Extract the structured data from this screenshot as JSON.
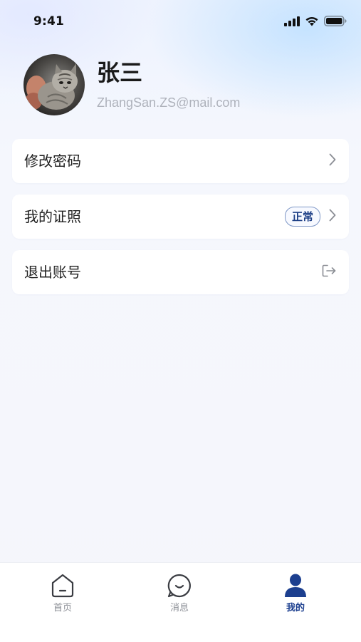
{
  "status_bar": {
    "time": "9:41",
    "icons": [
      "cellular-signal-icon",
      "wifi-icon",
      "battery-icon"
    ]
  },
  "profile": {
    "name": "张三",
    "email": "ZhangSan.ZS@mail.com",
    "avatar": "cat-photo-avatar"
  },
  "menu": {
    "items": [
      {
        "label": "修改密码",
        "icon": "chevron-right-icon"
      },
      {
        "label": "我的证照",
        "badge": "正常",
        "icon": "chevron-right-icon"
      },
      {
        "label": "退出账号",
        "icon": "logout-icon"
      }
    ]
  },
  "tab_bar": {
    "tabs": [
      {
        "label": "首页",
        "icon": "home-icon",
        "active": false
      },
      {
        "label": "消息",
        "icon": "message-icon",
        "active": false
      },
      {
        "label": "我的",
        "icon": "user-icon",
        "active": true
      }
    ]
  },
  "colors": {
    "accent": "#1c3f8f",
    "inactive_tab": "#8c8f96",
    "badge_text": "#1d3f86",
    "email_text": "#aeb2bb"
  }
}
